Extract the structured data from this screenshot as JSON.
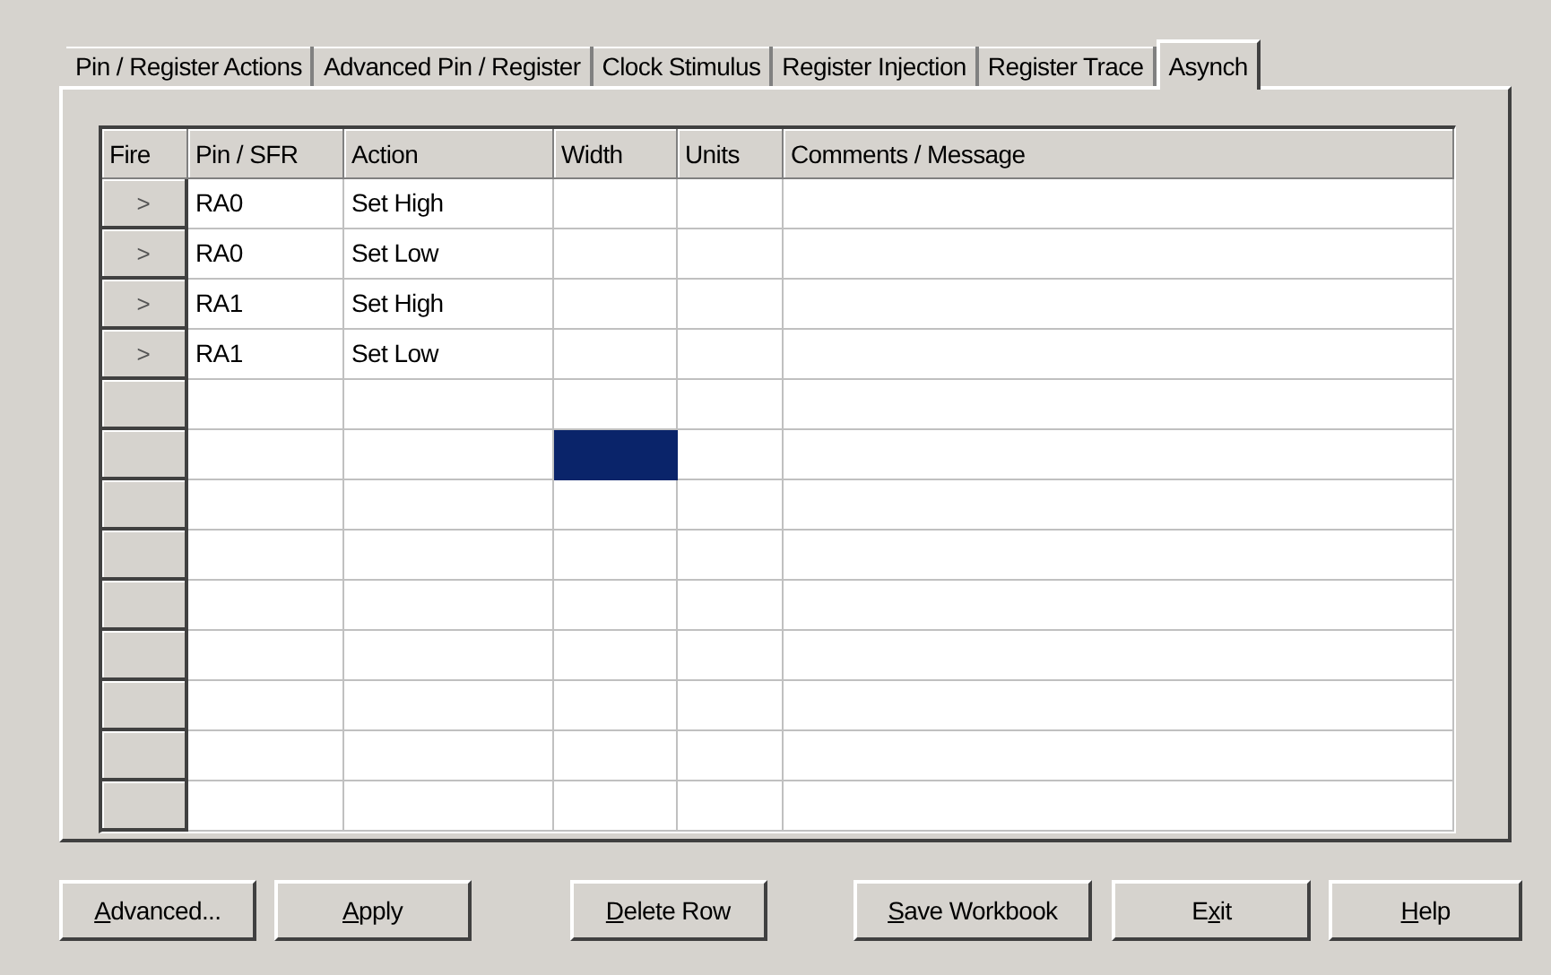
{
  "tabs": [
    {
      "label": "Pin / Register Actions",
      "selected": false
    },
    {
      "label": "Advanced Pin / Register",
      "selected": false
    },
    {
      "label": "Clock Stimulus",
      "selected": false
    },
    {
      "label": "Register Injection",
      "selected": false
    },
    {
      "label": "Register Trace",
      "selected": false
    },
    {
      "label": "Asynch",
      "selected": true
    }
  ],
  "table": {
    "columns": [
      "Fire",
      "Pin / SFR",
      "Action",
      "Width",
      "Units",
      "Comments / Message"
    ],
    "rows": [
      {
        "cells": [
          {
            "kind": "fire",
            "text": ">",
            "selected": false
          },
          {
            "text": "RA0",
            "selected": false
          },
          {
            "text": "Set High",
            "selected": false
          },
          {
            "selected": false
          },
          {
            "selected": false
          },
          {
            "selected": false
          }
        ]
      },
      {
        "cells": [
          {
            "kind": "fire",
            "text": ">",
            "selected": false
          },
          {
            "text": "RA0",
            "selected": false
          },
          {
            "text": "Set Low",
            "selected": false
          },
          {
            "selected": false
          },
          {
            "selected": false
          },
          {
            "selected": false
          }
        ]
      },
      {
        "cells": [
          {
            "kind": "fire",
            "text": ">",
            "selected": false
          },
          {
            "text": "RA1",
            "selected": false
          },
          {
            "text": "Set High",
            "selected": false
          },
          {
            "selected": false
          },
          {
            "selected": false
          },
          {
            "selected": false
          }
        ]
      },
      {
        "cells": [
          {
            "kind": "fire",
            "text": ">",
            "selected": false
          },
          {
            "text": "RA1",
            "selected": false
          },
          {
            "text": "Set Low",
            "selected": false
          },
          {
            "selected": false
          },
          {
            "selected": false
          },
          {
            "selected": false
          }
        ]
      },
      {
        "cells": [
          {
            "kind": "fire",
            "selected": false
          },
          {
            "selected": false
          },
          {
            "selected": false
          },
          {
            "selected": false
          },
          {
            "selected": false
          },
          {
            "selected": false
          }
        ]
      },
      {
        "cells": [
          {
            "kind": "fire",
            "selected": false
          },
          {
            "selected": false
          },
          {
            "selected": false
          },
          {
            "selected": true
          },
          {
            "selected": false
          },
          {
            "selected": false
          }
        ]
      },
      {
        "cells": [
          {
            "kind": "fire",
            "selected": false
          },
          {
            "selected": false
          },
          {
            "selected": false
          },
          {
            "selected": false
          },
          {
            "selected": false
          },
          {
            "selected": false
          }
        ]
      },
      {
        "cells": [
          {
            "kind": "fire",
            "selected": false
          },
          {
            "selected": false
          },
          {
            "selected": false
          },
          {
            "selected": false
          },
          {
            "selected": false
          },
          {
            "selected": false
          }
        ]
      },
      {
        "cells": [
          {
            "kind": "fire",
            "selected": false
          },
          {
            "selected": false
          },
          {
            "selected": false
          },
          {
            "selected": false
          },
          {
            "selected": false
          },
          {
            "selected": false
          }
        ]
      },
      {
        "cells": [
          {
            "kind": "fire",
            "selected": false
          },
          {
            "selected": false
          },
          {
            "selected": false
          },
          {
            "selected": false
          },
          {
            "selected": false
          },
          {
            "selected": false
          }
        ]
      },
      {
        "cells": [
          {
            "kind": "fire",
            "selected": false
          },
          {
            "selected": false
          },
          {
            "selected": false
          },
          {
            "selected": false
          },
          {
            "selected": false
          },
          {
            "selected": false
          }
        ]
      },
      {
        "cells": [
          {
            "kind": "fire",
            "selected": false
          },
          {
            "selected": false
          },
          {
            "selected": false
          },
          {
            "selected": false
          },
          {
            "selected": false
          },
          {
            "selected": false
          }
        ]
      },
      {
        "cells": [
          {
            "kind": "fire",
            "selected": false
          },
          {
            "selected": false
          },
          {
            "selected": false
          },
          {
            "selected": false
          },
          {
            "selected": false
          },
          {
            "selected": false
          }
        ]
      }
    ]
  },
  "buttons": [
    {
      "access_key": "A",
      "label_rest": "dvanced..."
    },
    {
      "access_key": "A",
      "label_rest": "pply"
    },
    {
      "access_key": "D",
      "label_rest": "elete Row"
    },
    {
      "access_key": "S",
      "label_rest": "ave Workbook"
    },
    {
      "label_start": "E",
      "access_key": "x",
      "label_rest": "it"
    },
    {
      "access_key": "H",
      "label_rest": "elp"
    }
  ]
}
